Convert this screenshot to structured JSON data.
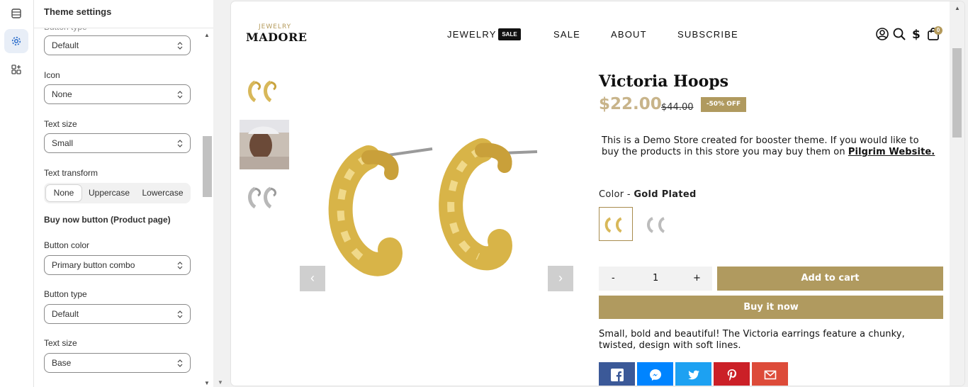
{
  "panel": {
    "title": "Theme settings",
    "cut_label": "Button type",
    "fields": {
      "button_type_1": "Default",
      "icon_label": "Icon",
      "icon_value": "None",
      "text_size_label_1": "Text size",
      "text_size_value_1": "Small",
      "text_transform_label": "Text transform",
      "text_transform_options": [
        "None",
        "Uppercase",
        "Lowercase"
      ],
      "text_transform_selected": "None",
      "section_buy_now": "Buy now button (Product page)",
      "button_color_label": "Button color",
      "button_color_value": "Primary button combo",
      "button_type_label": "Button type",
      "button_type_value": "Default",
      "text_size_label_2": "Text size",
      "text_size_value_2": "Base"
    }
  },
  "store": {
    "logo_small": "JEWELRY",
    "logo_big": "MADORE",
    "nav": [
      "JEWELRY",
      "SALE",
      "ABOUT",
      "SUBSCRIBE"
    ],
    "sale_badge": "SALE",
    "cart_count": "0",
    "accent": "#b09a5f"
  },
  "product": {
    "title": "Victoria Hoops",
    "price": "$22.00",
    "compare_price": "$44.00",
    "discount_badge": "-50% OFF",
    "description_text": "This is a Demo Store created for booster theme. If you would like to buy the products in this store you may buy them on ",
    "description_link": "Pilgrim Website.",
    "color_label": "Color",
    "color_separator": " - ",
    "color_value": "Gold Plated",
    "quantity_minus": "-",
    "quantity_value": "1",
    "quantity_plus": "+",
    "add_to_cart": "Add to cart",
    "buy_now": "Buy it now",
    "long_description": "Small, bold and beautiful! The Victoria earrings feature a chunky, twisted, design with soft lines.",
    "gallery_prev": "‹",
    "gallery_next": "›"
  },
  "share": [
    "facebook-icon",
    "messenger-icon",
    "twitter-icon",
    "pinterest-icon",
    "email-icon"
  ],
  "share_colors": [
    "#3b5998",
    "#0084ff",
    "#1da1f2",
    "#cb2027",
    "#dd4b39"
  ]
}
